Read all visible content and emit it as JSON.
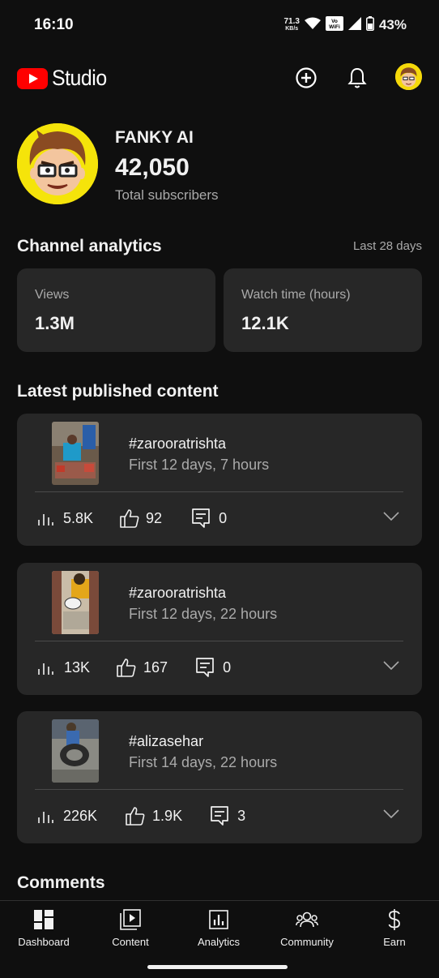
{
  "status_bar": {
    "time": "16:10",
    "net_speed": "71.3",
    "net_speed_unit": "KB/s",
    "wifi_call": "Vo WiFi",
    "battery": "43%"
  },
  "header": {
    "app_name": "Studio",
    "icons": [
      "create-icon",
      "notifications-icon",
      "account-avatar"
    ]
  },
  "channel": {
    "name": "FANKY AI",
    "subscribers": "42,050",
    "subscribers_label": "Total subscribers"
  },
  "analytics": {
    "title": "Channel analytics",
    "period": "Last 28 days",
    "cards": [
      {
        "label": "Views",
        "value": "1.3M"
      },
      {
        "label": "Watch time (hours)",
        "value": "12.1K"
      }
    ]
  },
  "latest": {
    "title": "Latest published content",
    "items": [
      {
        "title": "#zarooratrishta",
        "subtitle": "First 12 days, 7 hours",
        "views": "5.8K",
        "likes": "92",
        "comments": "0"
      },
      {
        "title": "#zarooratrishta",
        "subtitle": "First 12 days, 22 hours",
        "views": "13K",
        "likes": "167",
        "comments": "0"
      },
      {
        "title": "#alizasehar",
        "subtitle": "First 14 days, 22 hours",
        "views": "226K",
        "likes": "1.9K",
        "comments": "3"
      }
    ]
  },
  "comments_section": {
    "title": "Comments"
  },
  "bottom_nav": {
    "items": [
      {
        "label": "Dashboard",
        "icon": "dashboard-icon"
      },
      {
        "label": "Content",
        "icon": "content-icon"
      },
      {
        "label": "Analytics",
        "icon": "analytics-icon"
      },
      {
        "label": "Community",
        "icon": "community-icon"
      },
      {
        "label": "Earn",
        "icon": "earn-icon"
      }
    ]
  },
  "colors": {
    "background": "#0f0f0f",
    "card": "#272727",
    "brand_red": "#ff0000",
    "secondary_text": "#aaaaaa",
    "avatar_yellow": "#f5e40a"
  }
}
